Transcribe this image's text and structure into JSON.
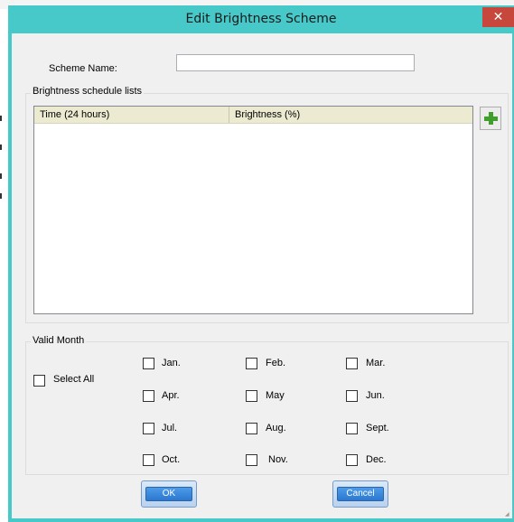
{
  "window": {
    "title": "Edit Brightness Scheme",
    "close_glyph": "✕"
  },
  "scheme_name": {
    "label": "Scheme Name:",
    "value": ""
  },
  "schedule": {
    "group_title": "Brightness schedule lists",
    "columns": [
      "Time (24 hours)",
      "Brightness (%)"
    ],
    "rows": [],
    "add_icon": "plus-icon"
  },
  "valid_month": {
    "group_title": "Valid Month",
    "select_all_label": "Select All",
    "months": [
      "Jan.",
      "Feb.",
      "Mar.",
      "Apr.",
      "May",
      "Jun.",
      "Jul.",
      "Aug.",
      "Sept.",
      "Oct.",
      "Nov.",
      "Dec."
    ]
  },
  "buttons": {
    "ok": "OK",
    "cancel": "Cancel"
  },
  "colors": {
    "titlebar": "#47c9c9",
    "close": "#c7473c",
    "header": "#ecebd1",
    "plus": "#3f9e2c"
  }
}
